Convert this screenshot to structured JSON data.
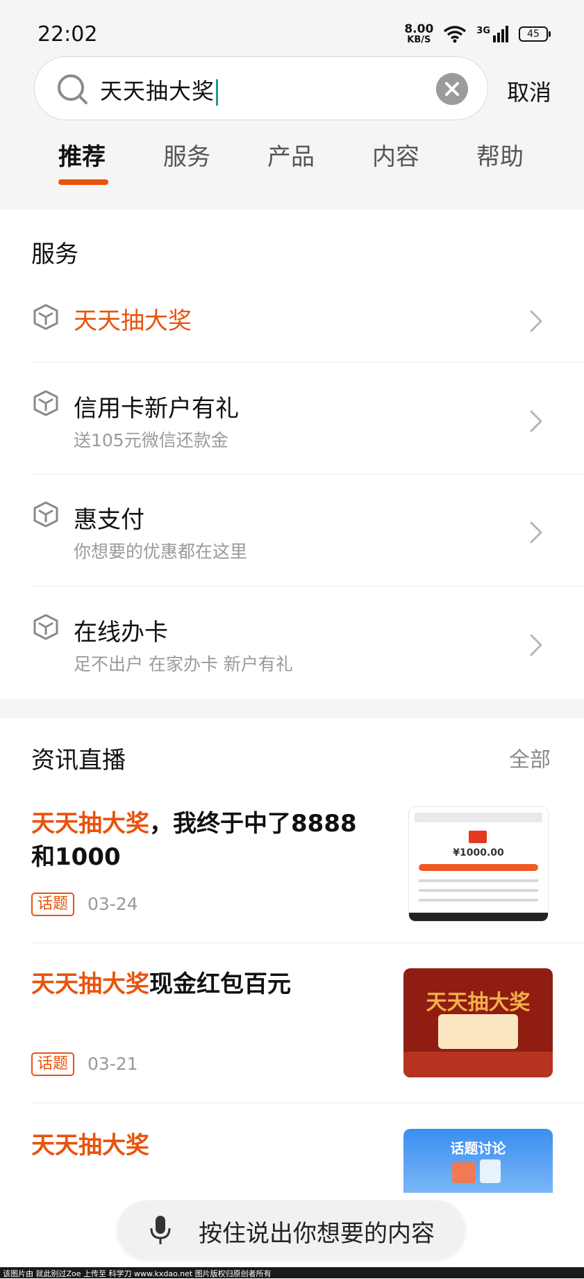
{
  "status_bar": {
    "time": "22:02",
    "net_speed_value": "8.00",
    "net_speed_unit": "KB/S",
    "signal_label": "3G",
    "battery": "45"
  },
  "search": {
    "query": "天天抽大奖",
    "cancel_label": "取消"
  },
  "tabs": [
    {
      "label": "推荐",
      "active": true
    },
    {
      "label": "服务",
      "active": false
    },
    {
      "label": "产品",
      "active": false
    },
    {
      "label": "内容",
      "active": false
    },
    {
      "label": "帮助",
      "active": false
    }
  ],
  "services": {
    "title": "服务",
    "items": [
      {
        "title": "天天抽大奖",
        "subtitle": "",
        "highlight": true
      },
      {
        "title": "信用卡新户有礼",
        "subtitle": "送105元微信还款金"
      },
      {
        "title": "惠支付",
        "subtitle": "你想要的优惠都在这里"
      },
      {
        "title": "在线办卡",
        "subtitle": "足不出户 在家办卡 新户有礼"
      }
    ]
  },
  "news": {
    "title": "资讯直播",
    "all_label": "全部",
    "items": [
      {
        "title_highlight": "天天抽大奖",
        "title_rest": "，我终于中了8888和1000",
        "tag": "话题",
        "date": "03-24",
        "thumb_text": "¥1000.00"
      },
      {
        "title_highlight": "天天抽大奖",
        "title_rest": "现金红包百元",
        "tag": "话题",
        "date": "03-21",
        "thumb_text": "天天抽大奖"
      },
      {
        "title_highlight": "天天抽大奖",
        "title_rest": "",
        "tag": "",
        "date": "",
        "thumb_text": "话题讨论"
      }
    ]
  },
  "voice": {
    "label": "按住说出你想要的内容"
  },
  "footer": {
    "text": "该图片由 就此别过Zoe 上传至 科学刀 www.kxdao.net 图片版权归原创者所有"
  },
  "colors": {
    "accent": "#e8530e",
    "caret": "#1e9c8f",
    "background": "#f5f5f5"
  }
}
